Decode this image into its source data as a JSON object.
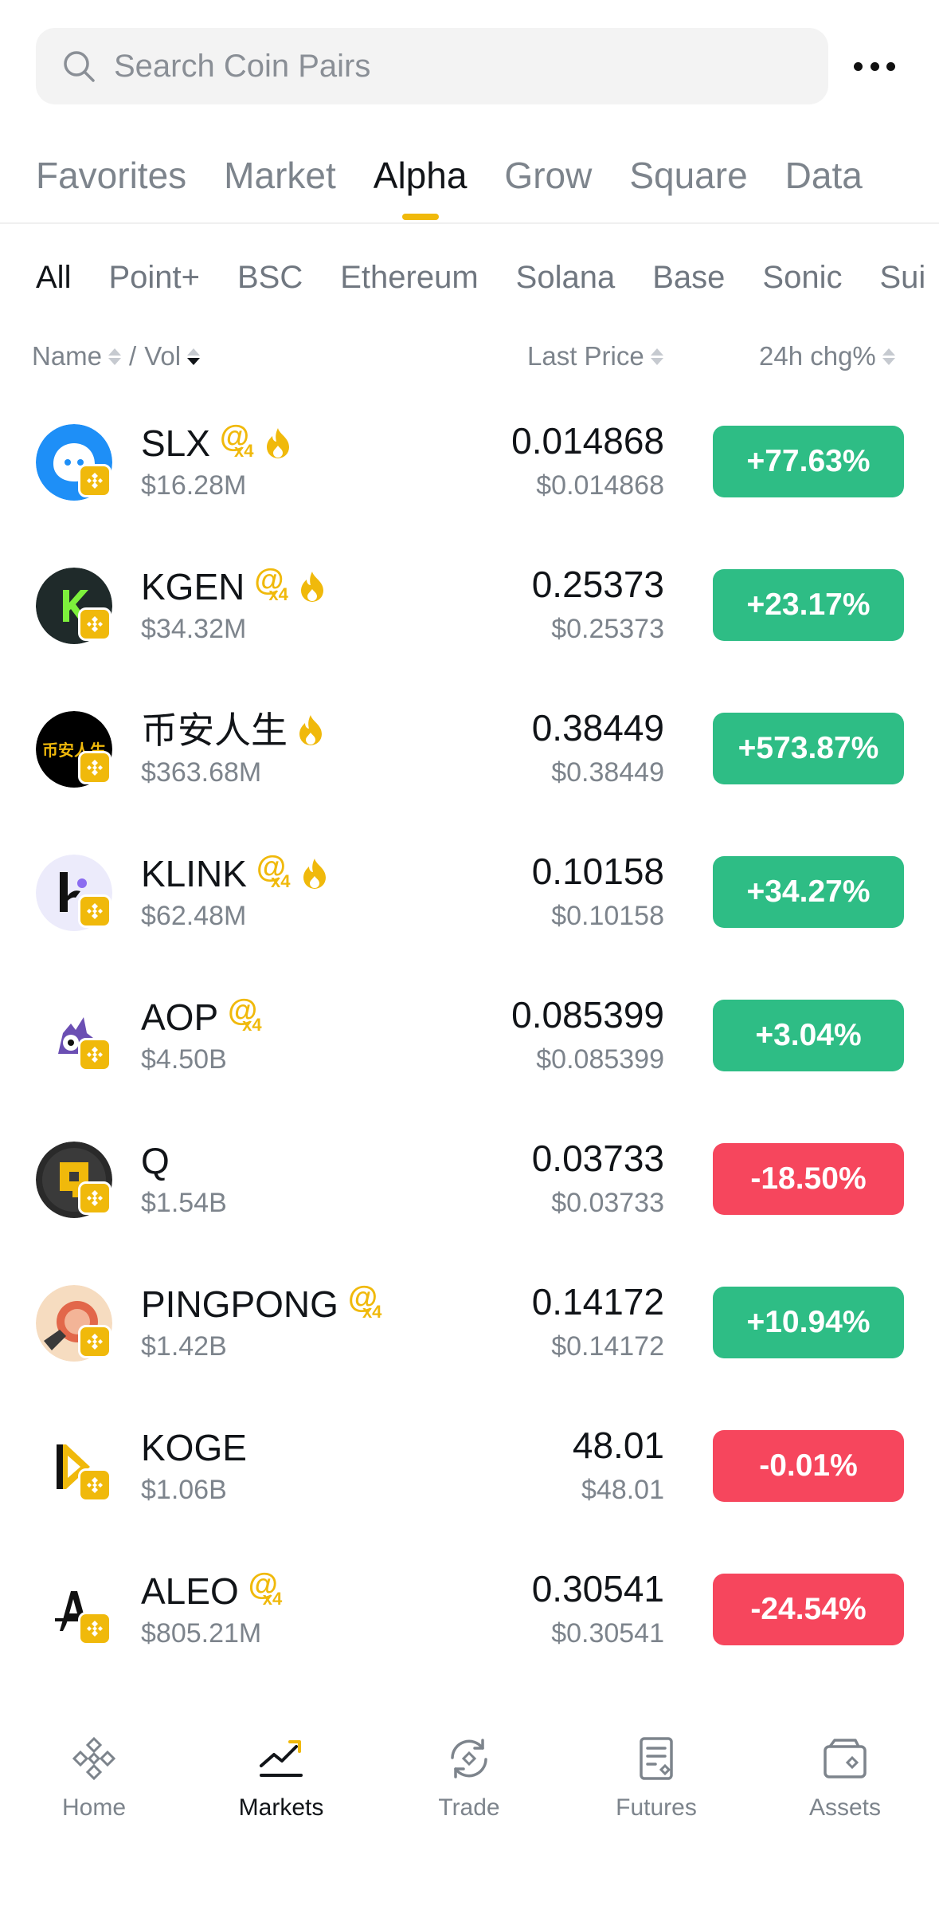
{
  "search": {
    "placeholder": "Search Coin Pairs"
  },
  "main_tabs": [
    {
      "label": "Favorites",
      "active": false
    },
    {
      "label": "Market",
      "active": false
    },
    {
      "label": "Alpha",
      "active": true
    },
    {
      "label": "Grow",
      "active": false
    },
    {
      "label": "Square",
      "active": false
    },
    {
      "label": "Data",
      "active": false
    }
  ],
  "chain_tabs": [
    {
      "label": "All",
      "active": true
    },
    {
      "label": "Point+",
      "active": false
    },
    {
      "label": "BSC",
      "active": false
    },
    {
      "label": "Ethereum",
      "active": false
    },
    {
      "label": "Solana",
      "active": false
    },
    {
      "label": "Base",
      "active": false
    },
    {
      "label": "Sonic",
      "active": false
    },
    {
      "label": "Sui",
      "active": false
    }
  ],
  "columns": {
    "name": "Name",
    "slash": "/",
    "vol": "Vol",
    "last_price": "Last Price",
    "change": "24h chg%"
  },
  "colors": {
    "accent": "#f0b90b",
    "up": "#2ebd85",
    "down": "#f6465d"
  },
  "coins": [
    {
      "symbol": "SLX",
      "volume": "$16.28M",
      "price": "0.014868",
      "usd_price": "$0.014868",
      "change": "+77.63%",
      "direction": "up",
      "multiplier": true,
      "hot": true,
      "logo": "slx-logo"
    },
    {
      "symbol": "KGEN",
      "volume": "$34.32M",
      "price": "0.25373",
      "usd_price": "$0.25373",
      "change": "+23.17%",
      "direction": "up",
      "multiplier": true,
      "hot": true,
      "logo": "kgen-logo"
    },
    {
      "symbol": "币安人生",
      "volume": "$363.68M",
      "price": "0.38449",
      "usd_price": "$0.38449",
      "change": "+573.87%",
      "direction": "up",
      "multiplier": false,
      "hot": true,
      "logo": "binance-life-logo",
      "logo_text": "币安人生"
    },
    {
      "symbol": "KLINK",
      "volume": "$62.48M",
      "price": "0.10158",
      "usd_price": "$0.10158",
      "change": "+34.27%",
      "direction": "up",
      "multiplier": true,
      "hot": true,
      "logo": "klink-logo"
    },
    {
      "symbol": "AOP",
      "volume": "$4.50B",
      "price": "0.085399",
      "usd_price": "$0.085399",
      "change": "+3.04%",
      "direction": "up",
      "multiplier": true,
      "hot": false,
      "logo": "aop-logo"
    },
    {
      "symbol": "Q",
      "volume": "$1.54B",
      "price": "0.03733",
      "usd_price": "$0.03733",
      "change": "-18.50%",
      "direction": "down",
      "multiplier": false,
      "hot": false,
      "logo": "q-logo"
    },
    {
      "symbol": "PINGPONG",
      "volume": "$1.42B",
      "price": "0.14172",
      "usd_price": "$0.14172",
      "change": "+10.94%",
      "direction": "up",
      "multiplier": true,
      "hot": false,
      "logo": "pingpong-logo"
    },
    {
      "symbol": "KOGE",
      "volume": "$1.06B",
      "price": "48.01",
      "usd_price": "$48.01",
      "change": "-0.01%",
      "direction": "down",
      "multiplier": false,
      "hot": false,
      "logo": "koge-logo"
    },
    {
      "symbol": "ALEO",
      "volume": "$805.21M",
      "price": "0.30541",
      "usd_price": "$0.30541",
      "change": "-24.54%",
      "direction": "down",
      "multiplier": true,
      "hot": false,
      "logo": "aleo-logo"
    }
  ],
  "badge": {
    "at": "@",
    "x4": "x4"
  },
  "nav": [
    {
      "label": "Home",
      "icon": "home-icon",
      "active": false
    },
    {
      "label": "Markets",
      "icon": "markets-icon",
      "active": true
    },
    {
      "label": "Trade",
      "icon": "trade-icon",
      "active": false
    },
    {
      "label": "Futures",
      "icon": "futures-icon",
      "active": false
    },
    {
      "label": "Assets",
      "icon": "assets-icon",
      "active": false
    }
  ]
}
